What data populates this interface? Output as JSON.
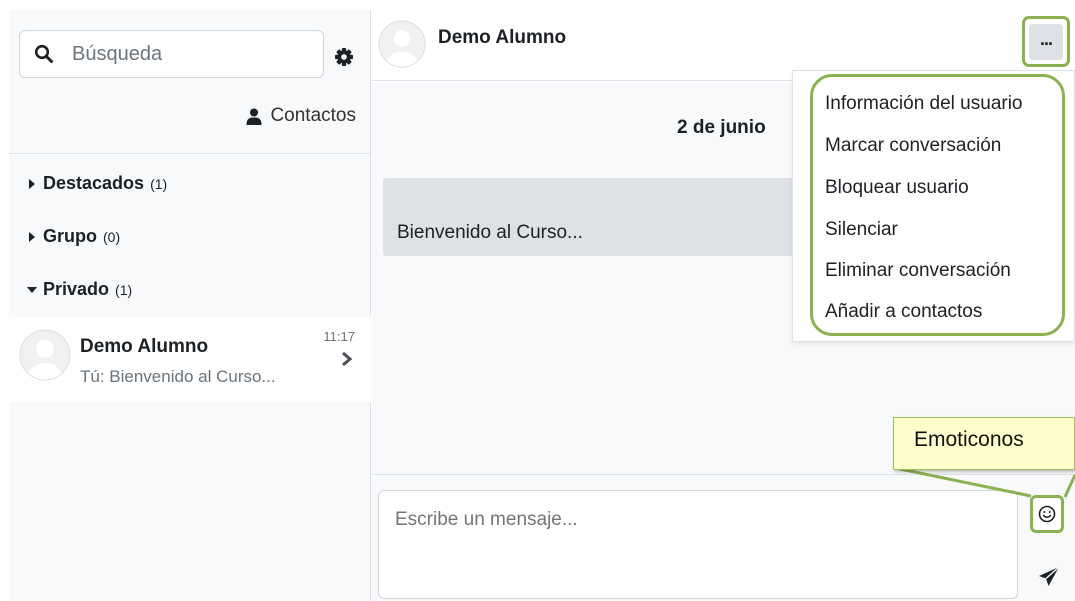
{
  "sidebar": {
    "search_placeholder": "Búsqueda",
    "contacts_label": "Contactos",
    "sections": [
      {
        "label": "Destacados",
        "count": "(1)"
      },
      {
        "label": "Grupo",
        "count": "(0)"
      },
      {
        "label": "Privado",
        "count": "(1)"
      }
    ],
    "conversation": {
      "name": "Demo Alumno",
      "preview": "Tú: Bienvenido al Curso...",
      "time": "11:17"
    }
  },
  "header": {
    "title": "Demo Alumno",
    "more_label": "..."
  },
  "messages": {
    "date": "2 de junio",
    "items": [
      {
        "text": "Bienvenido al Curso..."
      }
    ]
  },
  "menu": {
    "items": [
      {
        "label": "Información del usuario"
      },
      {
        "label": "Marcar conversación"
      },
      {
        "label": "Bloquear usuario"
      },
      {
        "label": "Silenciar"
      },
      {
        "label": "Eliminar conversación"
      },
      {
        "label": "Añadir a contactos"
      }
    ]
  },
  "composer": {
    "placeholder": "Escribe un mensaje..."
  },
  "tooltip": {
    "text": "Emoticonos"
  },
  "colors": {
    "highlight": "#8ab24e",
    "tooltip_bg": "#ffffcc",
    "panel_bg": "#f8f9fa",
    "bubble_bg": "#dee2e6"
  }
}
